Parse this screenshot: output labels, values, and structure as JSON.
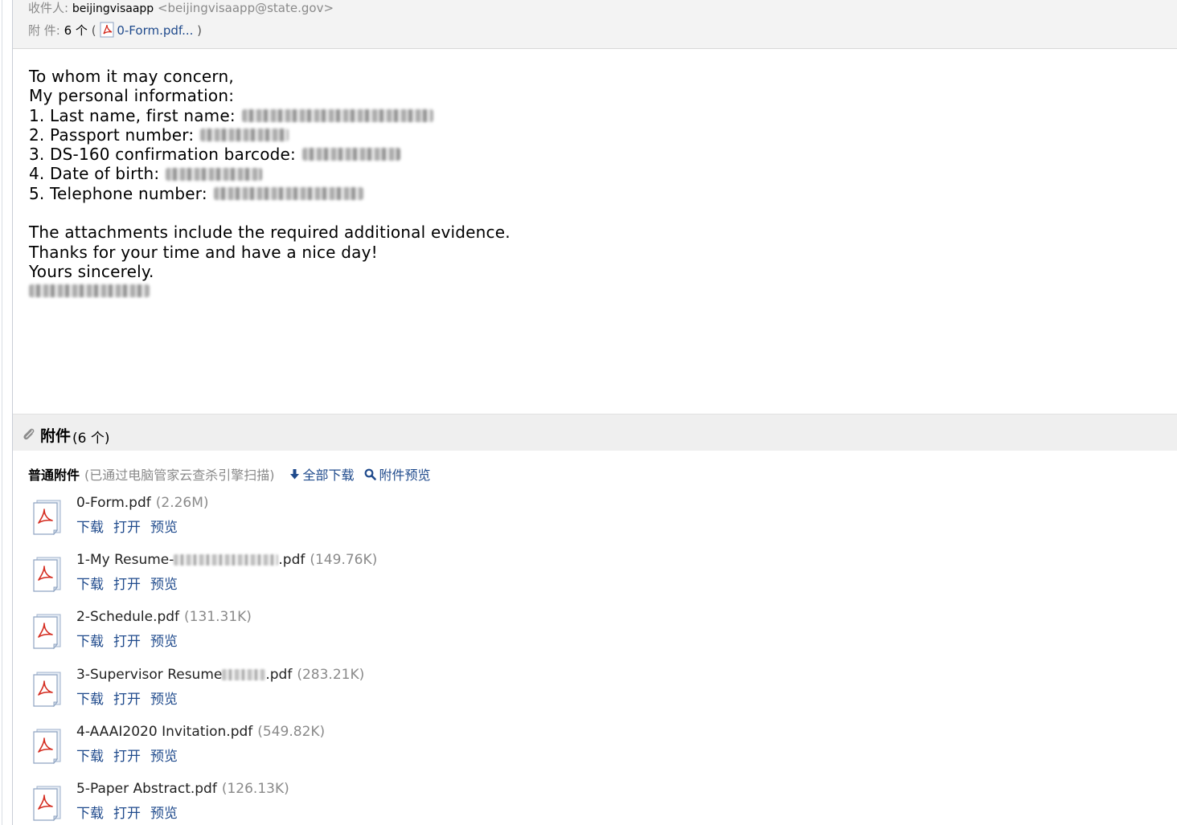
{
  "header": {
    "to_label": "收件人:",
    "to_name": "beijingvisaapp",
    "to_address": "<beijingvisaapp@state.gov>",
    "attach_label": "附 件:",
    "attach_count": "6 个",
    "attach_open_paren": "(",
    "attach_first": "0-Form.pdf...",
    "attach_close_paren": ")"
  },
  "body": {
    "greeting": "To whom it may concern,",
    "intro": "My personal information:",
    "items": [
      "1. Last name, first name:",
      "2. Passport number:",
      "3. DS-160 confirmation barcode:",
      "4. Date of birth:",
      "5. Telephone number:"
    ],
    "para1": "The attachments include the required additional evidence.",
    "para2": "Thanks for your time and have a nice day!",
    "closing": "Yours sincerely."
  },
  "attachments_panel": {
    "title": "附件",
    "count": "(6 个)",
    "section_heading": "普通附件",
    "scan_note": "(已通过电脑管家云查杀引擎扫描)",
    "download_all": "全部下载",
    "preview_all": "附件预览",
    "action_download": "下载",
    "action_open": "打开",
    "action_preview": "预览",
    "files": [
      {
        "name": "0-Form.pdf",
        "size": "(2.26M)"
      },
      {
        "prefix": "1-My Resume-",
        "suffix": ".pdf",
        "size": "(149.76K)"
      },
      {
        "name": "2-Schedule.pdf",
        "size": "(131.31K)"
      },
      {
        "prefix": "3-Supervisor Resume",
        "suffix": ".pdf",
        "size": "(283.21K)"
      },
      {
        "name": "4-AAAI2020 Invitation.pdf",
        "size": "(549.82K)"
      },
      {
        "name": "5-Paper Abstract.pdf",
        "size": "(126.13K)"
      }
    ]
  },
  "icons": {
    "pdf": "pdf-file-icon",
    "clip": "paperclip-icon",
    "download": "download-arrow-icon",
    "search": "magnifier-icon"
  },
  "colors": {
    "link": "#1f4a8c",
    "muted": "#8a8a8a",
    "header_bg": "#f3f3f3",
    "bar_bg": "#efefef",
    "pdf_red": "#d42a1e"
  }
}
